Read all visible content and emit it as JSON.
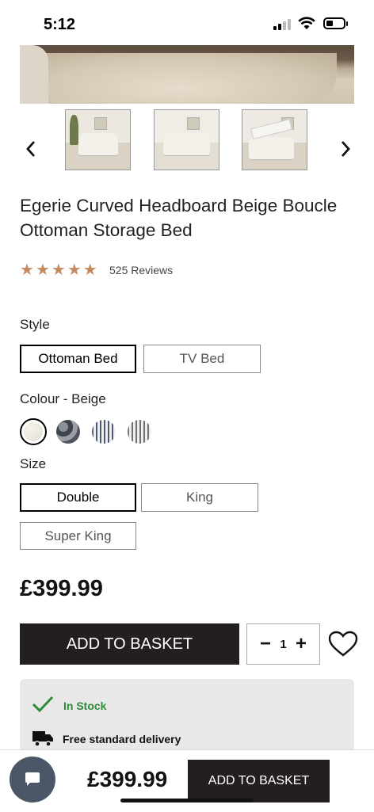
{
  "status_bar": {
    "time": "5:12"
  },
  "gallery": {
    "prev_icon": "chevron-left-icon",
    "next_icon": "chevron-right-icon",
    "thumbnails": [
      "bed-front-view",
      "bed-side-view",
      "bed-ottoman-open"
    ]
  },
  "product": {
    "title": "Egerie Curved Headboard Beige Boucle Ottoman Storage Bed",
    "rating_stars": 5,
    "reviews": "525 Reviews"
  },
  "style": {
    "label": "Style",
    "options": [
      "Ottoman Bed",
      "TV Bed"
    ],
    "selected": "Ottoman Bed"
  },
  "colour": {
    "label": "Colour - Beige",
    "swatches": [
      "beige-boucle",
      "grey-boucle",
      "blue-stripe",
      "grey-stripe"
    ],
    "selected": "beige-boucle"
  },
  "size": {
    "label": "Size",
    "options": [
      "Double",
      "King",
      "Super King"
    ],
    "selected": "Double"
  },
  "price": "£399.99",
  "actions": {
    "add_to_basket": "ADD TO BASKET",
    "quantity": "1",
    "minus": "−",
    "plus": "+"
  },
  "stock": {
    "in_stock": "In Stock",
    "delivery": "Free standard delivery"
  },
  "sticky_bar": {
    "price": "£399.99",
    "add_to_basket": "ADD TO BASKET"
  },
  "colors": {
    "star": "#c48b63",
    "button_bg": "#231f20",
    "in_stock": "#2e8b3a",
    "chat_bubble": "#4b5666"
  }
}
